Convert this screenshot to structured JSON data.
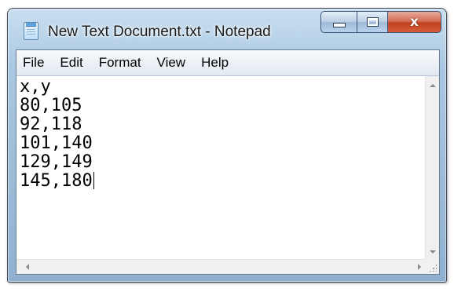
{
  "window": {
    "title": "New Text Document.txt - Notepad",
    "icon": "notepad-icon",
    "close_glyph": "x"
  },
  "menu": [
    {
      "label": "File"
    },
    {
      "label": "Edit"
    },
    {
      "label": "Format"
    },
    {
      "label": "View"
    },
    {
      "label": "Help"
    }
  ],
  "document": {
    "lines": [
      "x,y",
      "80,105",
      "92,118",
      "101,140",
      "129,149",
      "145,180"
    ]
  },
  "colors": {
    "titlebar": "#a9c7e2",
    "close_button": "#c2401f"
  }
}
